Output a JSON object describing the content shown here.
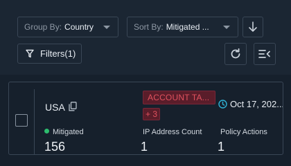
{
  "toolbar": {
    "group_by": {
      "label": "Group By:",
      "value": "Country"
    },
    "sort_by": {
      "label": "Sort By:",
      "value": "Mitigated ..."
    },
    "filters_label": "Filters(1)"
  },
  "card": {
    "country": "USA",
    "tag": "ACCOUNT TA...",
    "tag_more": "+ 3",
    "date": "Oct 17, 202...",
    "metrics": [
      {
        "label": "Mitigated",
        "value": "156",
        "status_color": "#2dbd6e"
      },
      {
        "label": "IP Address Count",
        "value": "1"
      },
      {
        "label": "Policy Actions",
        "value": "1"
      }
    ]
  },
  "colors": {
    "background": "#16202c",
    "panel": "#1b2633",
    "border": "#3a4756",
    "tag_bg": "#5a1d2a",
    "tag_text": "#e0525f",
    "clock_accent": "#2fb3d6"
  }
}
